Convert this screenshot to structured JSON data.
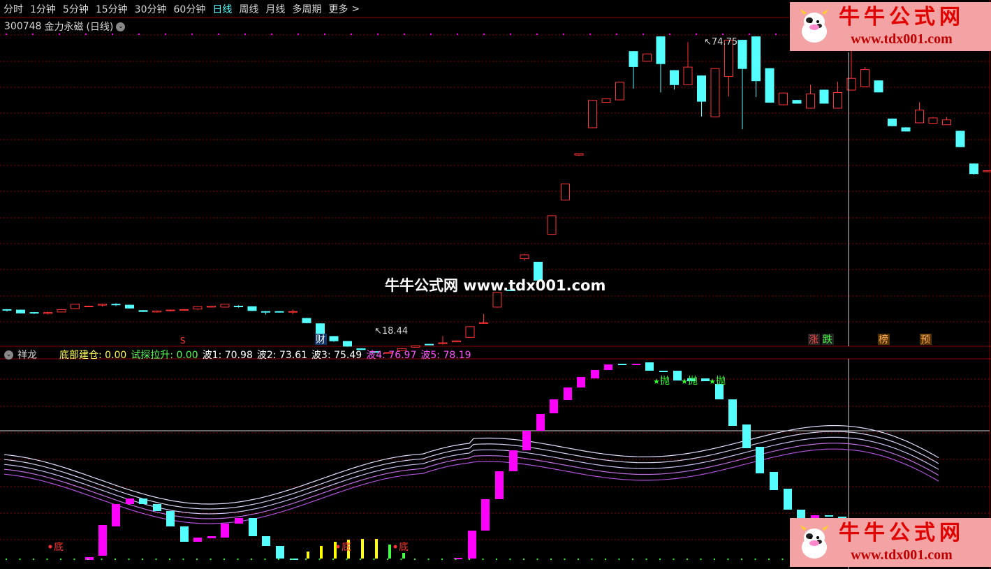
{
  "toolbar": {
    "tabs": [
      "分时",
      "1分钟",
      "5分钟",
      "15分钟",
      "30分钟",
      "60分钟",
      "日线",
      "周线",
      "月线",
      "多周期",
      "更多"
    ],
    "active_tab": "日线",
    "more_suffix": ">"
  },
  "stock": {
    "code": "300748",
    "name": "金力永磁",
    "period": "(日线)"
  },
  "price_labels": {
    "high": "74.75",
    "low": "18.44"
  },
  "event_markers": {
    "zhang": "涨",
    "die": "跌",
    "bang": "榜",
    "yu": "预",
    "cai": "财",
    "s": "S"
  },
  "indicator": {
    "name": "祥龙",
    "values": [
      {
        "label": "底部建仓: ",
        "value": "0.00",
        "color": "#ffff55"
      },
      {
        "label": "试探拉升: ",
        "value": "0.00",
        "color": "#55ff55"
      },
      {
        "label": "波1: ",
        "value": "70.98",
        "color": "#ffffff"
      },
      {
        "label": "波2: ",
        "value": "73.61",
        "color": "#ffffff"
      },
      {
        "label": "波3: ",
        "value": "75.49",
        "color": "#ffffff"
      },
      {
        "label": "波4: ",
        "value": "76.97",
        "color": "#ff55ff"
      },
      {
        "label": "波5: ",
        "value": "78.19",
        "color": "#ff55ff"
      }
    ],
    "signal_sell": "抛",
    "signal_bottom": "底"
  },
  "logo": {
    "title": "牛牛公式网",
    "url": "www.tdx001.com"
  },
  "watermark": "牛牛公式网 www.tdx001.com",
  "colors": {
    "up": "#ff3333",
    "down": "#55ffff",
    "magenta": "#ff00ff",
    "grid": "#8b0000"
  },
  "chart_data": {
    "type": "candlestick",
    "candles_ohlc": [
      [
        19.6,
        19.5,
        19.2,
        19.7
      ],
      [
        19.5,
        18.9,
        18.8,
        19.6
      ],
      [
        19.0,
        18.9,
        18.7,
        19.1
      ],
      [
        18.8,
        19.0,
        18.6,
        19.2
      ],
      [
        19.1,
        19.6,
        19.0,
        19.7
      ],
      [
        19.8,
        20.7,
        19.7,
        20.8
      ],
      [
        20.2,
        20.3,
        20.1,
        20.4
      ],
      [
        20.5,
        20.7,
        20.2,
        20.8
      ],
      [
        20.7,
        20.6,
        20.3,
        20.9
      ],
      [
        20.5,
        19.9,
        19.8,
        20.6
      ],
      [
        19.4,
        19.2,
        19.1,
        19.5
      ],
      [
        19.1,
        19.3,
        19.0,
        19.4
      ],
      [
        19.4,
        19.5,
        19.2,
        19.6
      ],
      [
        19.5,
        19.6,
        19.4,
        19.7
      ],
      [
        19.7,
        20.2,
        19.5,
        20.3
      ],
      [
        20.1,
        20.3,
        20.0,
        20.4
      ],
      [
        20.1,
        20.7,
        20.0,
        20.8
      ],
      [
        20.3,
        20.2,
        20.0,
        20.5
      ],
      [
        20.2,
        19.4,
        19.3,
        20.3
      ],
      [
        19.2,
        19.1,
        18.6,
        19.3
      ],
      [
        19.2,
        19.1,
        19.0,
        19.3
      ],
      [
        19.1,
        19.2,
        18.7,
        19.6
      ],
      [
        17.8,
        16.9,
        16.8,
        17.9
      ],
      [
        16.7,
        14.7,
        14.6,
        16.8
      ],
      [
        14.1,
        13.2,
        13.0,
        14.2
      ],
      [
        13.1,
        12.1,
        12.0,
        13.2
      ],
      [
        11.6,
        11.4,
        11.3,
        11.7
      ],
      [
        11.0,
        10.9,
        10.8,
        11.1
      ],
      [
        10.7,
        10.8,
        10.6,
        10.9
      ],
      [
        11.2,
        11.6,
        11.1,
        11.7
      ],
      [
        11.9,
        12.2,
        11.8,
        12.3
      ],
      [
        12.5,
        12.4,
        12.3,
        12.6
      ],
      [
        12.6,
        12.8,
        12.4,
        14.2
      ],
      [
        13.0,
        13.2,
        12.9,
        13.3
      ],
      [
        13.9,
        16.1,
        13.8,
        16.2
      ],
      [
        16.8,
        16.9,
        16.7,
        18.7
      ],
      [
        20.1,
        23.1,
        20.0,
        23.2
      ],
      [
        23.6,
        23.5,
        23.4,
        23.7
      ],
      [
        30.0,
        30.8,
        29.6,
        31.0
      ],
      [
        29.3,
        25.6,
        25.5,
        29.4
      ],
      [
        35.0,
        38.8,
        34.9,
        38.9
      ],
      [
        42.0,
        45.3,
        41.9,
        45.4
      ],
      [
        51.2,
        51.5,
        51.0,
        51.6
      ],
      [
        56.8,
        62.4,
        56.7,
        62.5
      ],
      [
        62.0,
        62.7,
        61.9,
        62.8
      ],
      [
        62.5,
        66.1,
        62.4,
        66.2
      ],
      [
        72.4,
        69.3,
        64.8,
        72.5
      ],
      [
        70.4,
        71.9,
        70.3,
        72.0
      ],
      [
        75.4,
        69.9,
        64.0,
        75.5
      ],
      [
        68.5,
        65.6,
        64.6,
        68.6
      ],
      [
        65.6,
        69.2,
        65.5,
        74.3
      ],
      [
        67.4,
        62.2,
        59.1,
        67.5
      ],
      [
        59.0,
        68.9,
        58.9,
        69.0
      ],
      [
        67.3,
        74.7,
        63.2,
        74.8
      ],
      [
        74.7,
        68.9,
        56.5,
        74.8
      ],
      [
        75.4,
        66.4,
        63.1,
        75.5
      ],
      [
        68.9,
        62.0,
        61.9,
        69.0
      ],
      [
        61.5,
        63.9,
        61.4,
        64.0
      ],
      [
        62.4,
        61.8,
        61.7,
        62.5
      ],
      [
        60.8,
        63.7,
        60.7,
        65.6
      ],
      [
        64.5,
        61.8,
        61.7,
        64.6
      ],
      [
        60.8,
        64.0,
        60.7,
        66.2
      ],
      [
        64.5,
        66.9,
        64.4,
        72.5
      ],
      [
        65.2,
        68.7,
        65.1,
        69.2
      ],
      [
        66.4,
        64.1,
        64.0,
        66.5
      ],
      [
        58.6,
        57.2,
        57.1,
        58.7
      ],
      [
        56.8,
        56.1,
        56.0,
        56.9
      ],
      [
        57.8,
        60.4,
        57.7,
        62.0
      ],
      [
        57.7,
        58.8,
        57.6,
        59.0
      ],
      [
        57.4,
        58.4,
        57.3,
        59.0
      ],
      [
        56.1,
        52.9,
        52.8,
        56.2
      ],
      [
        49.4,
        47.4,
        47.2,
        49.5
      ],
      [
        47.8,
        48.0,
        47.7,
        48.1
      ]
    ]
  }
}
